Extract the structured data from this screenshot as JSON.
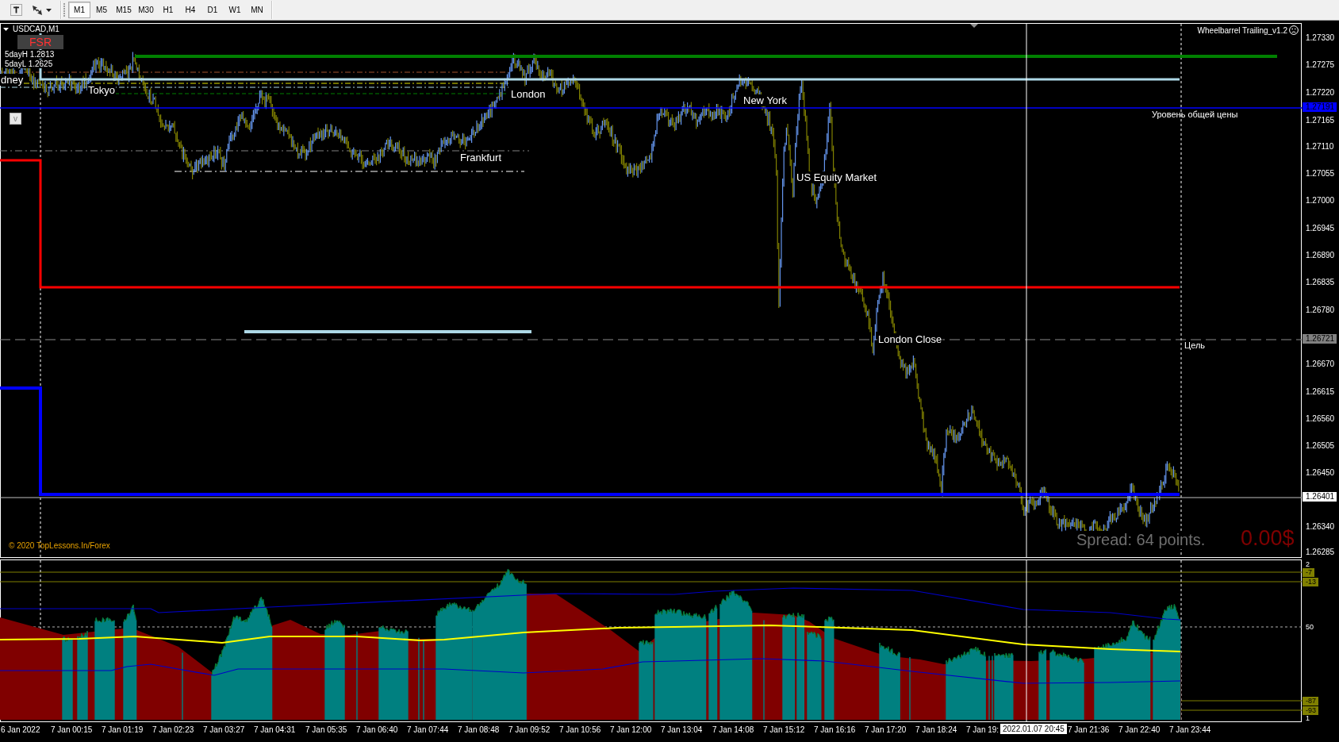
{
  "toolbar": {
    "timeframes": [
      {
        "label": "M1",
        "selected": true
      },
      {
        "label": "M5",
        "selected": false
      },
      {
        "label": "M15",
        "selected": false
      },
      {
        "label": "M30",
        "selected": false
      },
      {
        "label": "H1",
        "selected": false
      },
      {
        "label": "H4",
        "selected": false
      },
      {
        "label": "D1",
        "selected": false
      },
      {
        "label": "W1",
        "selected": false
      },
      {
        "label": "MN",
        "selected": false
      }
    ]
  },
  "chart": {
    "symbol": "USDCAD,M1",
    "badge": "FSR",
    "five_day_stats": [
      "5dayH 1.2813",
      "5dayL 1.2625"
    ],
    "toggle_button": "v",
    "expert_name": "Wheelbarrel Trailing_v1.2",
    "session_labels": [
      "dney",
      "Tokyo",
      "London",
      "Frankfurt",
      "New York",
      "US Equity Market",
      "London Close"
    ],
    "level_labels": [
      "Уровень общей цены",
      "Цель"
    ],
    "copyright": "© 2020 TopLessons.In/Forex",
    "spread": "Spread: 64 points.",
    "profit": "0.00$",
    "price_axis": [
      {
        "label": "1.27330",
        "kind": "tick"
      },
      {
        "label": "1.27275",
        "kind": "tick"
      },
      {
        "label": "1.27220",
        "kind": "tick"
      },
      {
        "label": "1.27191",
        "kind": "line"
      },
      {
        "label": "1.27165",
        "kind": "tick"
      },
      {
        "label": "1.27110",
        "kind": "tick"
      },
      {
        "label": "1.27055",
        "kind": "tick"
      },
      {
        "label": "1.27000",
        "kind": "tick"
      },
      {
        "label": "1.26945",
        "kind": "tick"
      },
      {
        "label": "1.26890",
        "kind": "tick"
      },
      {
        "label": "1.26835",
        "kind": "tick"
      },
      {
        "label": "1.26780",
        "kind": "tick"
      },
      {
        "label": "1.26721",
        "kind": "target"
      },
      {
        "label": "1.26670",
        "kind": "tick"
      },
      {
        "label": "1.26615",
        "kind": "tick"
      },
      {
        "label": "1.26560",
        "kind": "tick"
      },
      {
        "label": "1.26505",
        "kind": "tick"
      },
      {
        "label": "1.26450",
        "kind": "tick"
      },
      {
        "label": "1.26401",
        "kind": "bid"
      },
      {
        "label": "1.26340",
        "kind": "tick"
      },
      {
        "label": "1.26285",
        "kind": "tick"
      }
    ]
  },
  "indicator": {
    "axis": [
      {
        "label": "2",
        "kind": "tick"
      },
      {
        "label": "-7",
        "kind": "level"
      },
      {
        "label": "-13",
        "kind": "level"
      },
      {
        "label": "50",
        "kind": "tick"
      },
      {
        "label": "-87",
        "kind": "level"
      },
      {
        "label": "-93",
        "kind": "level"
      },
      {
        "label": "1",
        "kind": "tick"
      }
    ]
  },
  "time_axis": {
    "labels": [
      "6 Jan 2022",
      "7 Jan 00:15",
      "7 Jan 01:19",
      "7 Jan 02:23",
      "7 Jan 03:27",
      "7 Jan 04:31",
      "7 Jan 05:35",
      "7 Jan 06:40",
      "7 Jan 07:44",
      "7 Jan 08:48",
      "7 Jan 09:52",
      "7 Jan 10:56",
      "7 Jan 12:00",
      "7 Jan 13:04",
      "7 Jan 14:08",
      "7 Jan 15:12",
      "7 Jan 16:16",
      "7 Jan 17:20",
      "7 Jan 18:24",
      "7 Jan 19:",
      "7 Jan 21:36",
      "7 Jan 22:40",
      "7 Jan 23:44"
    ],
    "crosshair_time": "2022.01.07 20:45"
  }
}
